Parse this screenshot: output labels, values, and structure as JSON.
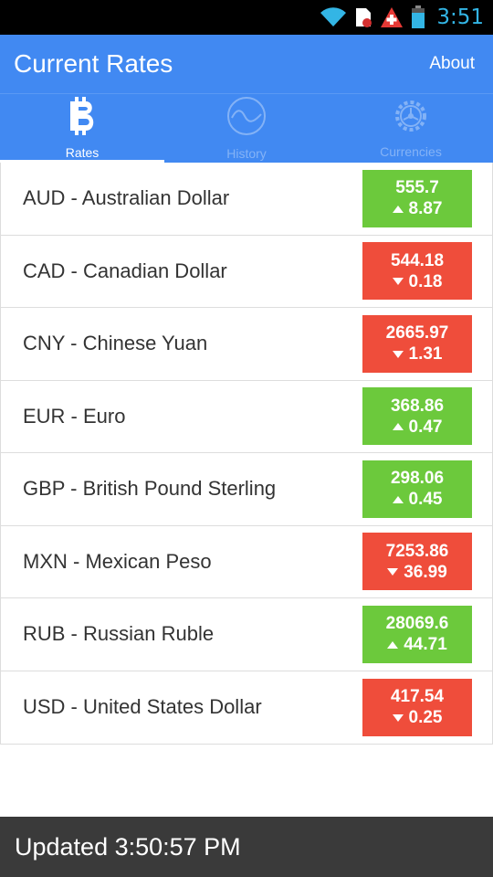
{
  "status_bar": {
    "time": "3:51",
    "icons": [
      "wifi-icon",
      "sim-icon",
      "medical-icon",
      "battery-icon"
    ]
  },
  "app_bar": {
    "title": "Current Rates",
    "about_label": "About"
  },
  "tabs": [
    {
      "label": "Rates",
      "icon": "bitcoin-icon",
      "active": true
    },
    {
      "label": "History",
      "icon": "wave-icon",
      "active": false
    },
    {
      "label": "Currencies",
      "icon": "gear-icon",
      "active": false
    }
  ],
  "rates": [
    {
      "name": "AUD - Australian Dollar",
      "rate": "555.7",
      "change": "8.87",
      "direction": "up"
    },
    {
      "name": "CAD - Canadian Dollar",
      "rate": "544.18",
      "change": "0.18",
      "direction": "down"
    },
    {
      "name": "CNY - Chinese Yuan",
      "rate": "2665.97",
      "change": "1.31",
      "direction": "down"
    },
    {
      "name": "EUR - Euro",
      "rate": "368.86",
      "change": "0.47",
      "direction": "up"
    },
    {
      "name": "GBP - British Pound Sterling",
      "rate": "298.06",
      "change": "0.45",
      "direction": "up"
    },
    {
      "name": "MXN - Mexican Peso",
      "rate": "7253.86",
      "change": "36.99",
      "direction": "down"
    },
    {
      "name": "RUB - Russian Ruble",
      "rate": "28069.6",
      "change": "44.71",
      "direction": "up"
    },
    {
      "name": "USD - United States Dollar",
      "rate": "417.54",
      "change": "0.25",
      "direction": "down"
    }
  ],
  "colors": {
    "primary": "#4189f2",
    "up": "#6cc93c",
    "down": "#ef4d3b",
    "footer": "#3a3a3a"
  },
  "footer": {
    "updated_text": "Updated 3:50:57 PM"
  }
}
